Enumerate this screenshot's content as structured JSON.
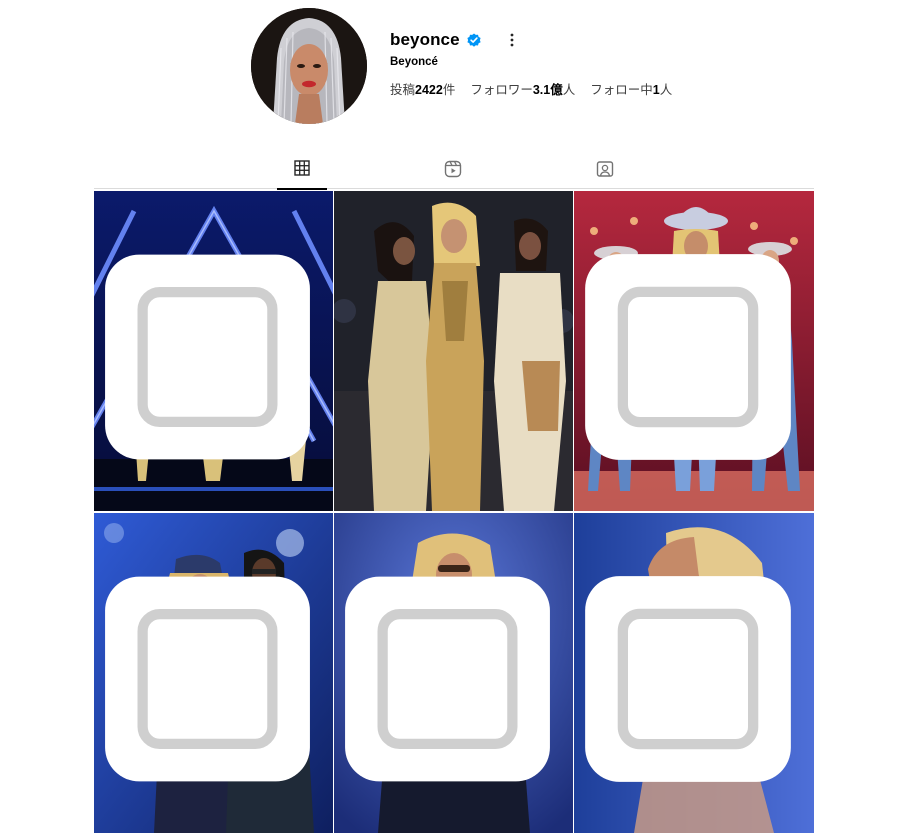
{
  "profile": {
    "username": "beyonce",
    "full_name": "Beyoncé",
    "stats": {
      "posts_label": "投稿",
      "posts_value": "2422",
      "posts_unit": "件",
      "followers_label": "フォロワー",
      "followers_value": "3.1億",
      "followers_unit": "人",
      "following_label": "フォロー中",
      "following_value": "1",
      "following_unit": "人"
    },
    "verified_color": "#0095f6",
    "icons": {
      "verified": "verified-badge-icon",
      "more": "more-options-icon"
    }
  },
  "tabs": [
    {
      "name": "posts",
      "icon": "grid-icon",
      "active": true
    },
    {
      "name": "reels",
      "icon": "reels-icon",
      "active": false
    },
    {
      "name": "tagged",
      "icon": "tagged-icon",
      "active": false
    }
  ],
  "posts": [
    {
      "id": "post-1",
      "multi": true
    },
    {
      "id": "post-2",
      "multi": false
    },
    {
      "id": "post-3",
      "multi": true
    },
    {
      "id": "post-4",
      "multi": true
    },
    {
      "id": "post-5",
      "multi": true
    },
    {
      "id": "post-6",
      "multi": true
    }
  ]
}
